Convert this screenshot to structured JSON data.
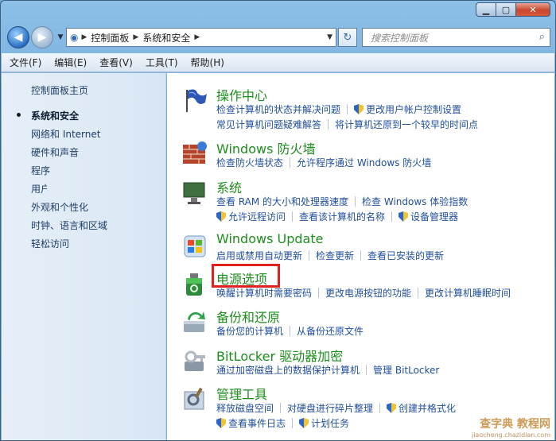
{
  "window": {
    "min_label": "▁",
    "max_label": "▢",
    "close_label": "✕"
  },
  "nav": {
    "back_icon": "◀",
    "forward_icon": "▶",
    "breadcrumb": [
      "控制面板",
      "系统和安全"
    ],
    "search_placeholder": "搜索控制面板",
    "refresh_icon": "↻",
    "search_icon": "⌕"
  },
  "menu": [
    "文件(F)",
    "编辑(E)",
    "查看(V)",
    "工具(T)",
    "帮助(H)"
  ],
  "sidebar": {
    "items": [
      "控制面板主页",
      "系统和安全",
      "网络和 Internet",
      "硬件和声音",
      "程序",
      "用户帐户和家庭安全",
      "外观和个性化",
      "时钟、语言和区域",
      "轻松访问"
    ],
    "active_index": 1
  },
  "categories": [
    {
      "title": "操作中心",
      "icon": "flag-icon",
      "rows": [
        [
          {
            "t": "检查计算机的状态并解决问题"
          },
          {
            "t": "更改用户帐户控制设置",
            "shield": true
          }
        ],
        [
          {
            "t": "常见计算机问题疑难解答"
          },
          {
            "t": "将计算机还原到一个较早的时间点"
          }
        ]
      ]
    },
    {
      "title": "Windows 防火墙",
      "icon": "firewall-icon",
      "rows": [
        [
          {
            "t": "检查防火墙状态"
          },
          {
            "t": "允许程序通过 Windows 防火墙"
          }
        ]
      ]
    },
    {
      "title": "系统",
      "icon": "system-icon",
      "rows": [
        [
          {
            "t": "查看 RAM 的大小和处理器速度"
          },
          {
            "t": "检查 Windows 体验指数"
          }
        ],
        [
          {
            "t": "允许远程访问",
            "shield": true
          },
          {
            "t": "查看该计算机的名称"
          },
          {
            "t": "设备管理器",
            "shield": true
          }
        ]
      ]
    },
    {
      "title": "Windows Update",
      "icon": "windows-update-icon",
      "rows": [
        [
          {
            "t": "启用或禁用自动更新"
          },
          {
            "t": "检查更新"
          },
          {
            "t": "查看已安装的更新"
          }
        ]
      ]
    },
    {
      "title": "电源选项",
      "icon": "power-icon",
      "rows": [
        [
          {
            "t": "唤醒计算机时需要密码"
          },
          {
            "t": "更改电源按钮的功能"
          },
          {
            "t": "更改计算机睡眠时间"
          }
        ]
      ]
    },
    {
      "title": "备份和还原",
      "icon": "backup-icon",
      "rows": [
        [
          {
            "t": "备份您的计算机"
          },
          {
            "t": "从备份还原文件"
          }
        ]
      ]
    },
    {
      "title": "BitLocker 驱动器加密",
      "icon": "bitlocker-icon",
      "rows": [
        [
          {
            "t": "通过加密磁盘上的数据保护计算机"
          },
          {
            "t": "管理 BitLocker"
          }
        ]
      ]
    },
    {
      "title": "管理工具",
      "icon": "admin-tools-icon",
      "rows": [
        [
          {
            "t": "释放磁盘空间"
          },
          {
            "t": "对硬盘进行碎片整理"
          },
          {
            "t": "创建并格式化",
            "shield": true
          }
        ],
        [
          {
            "t": "查看事件日志",
            "shield": true
          },
          {
            "t": "计划任务",
            "shield": true
          }
        ]
      ]
    }
  ],
  "watermark": {
    "main": "查字典 教程网",
    "sub": "jiaocheng.chazidian.com"
  },
  "colors": {
    "category_title": "#1c8e1c",
    "link": "#1f4e9e",
    "highlight": "#e12020"
  }
}
